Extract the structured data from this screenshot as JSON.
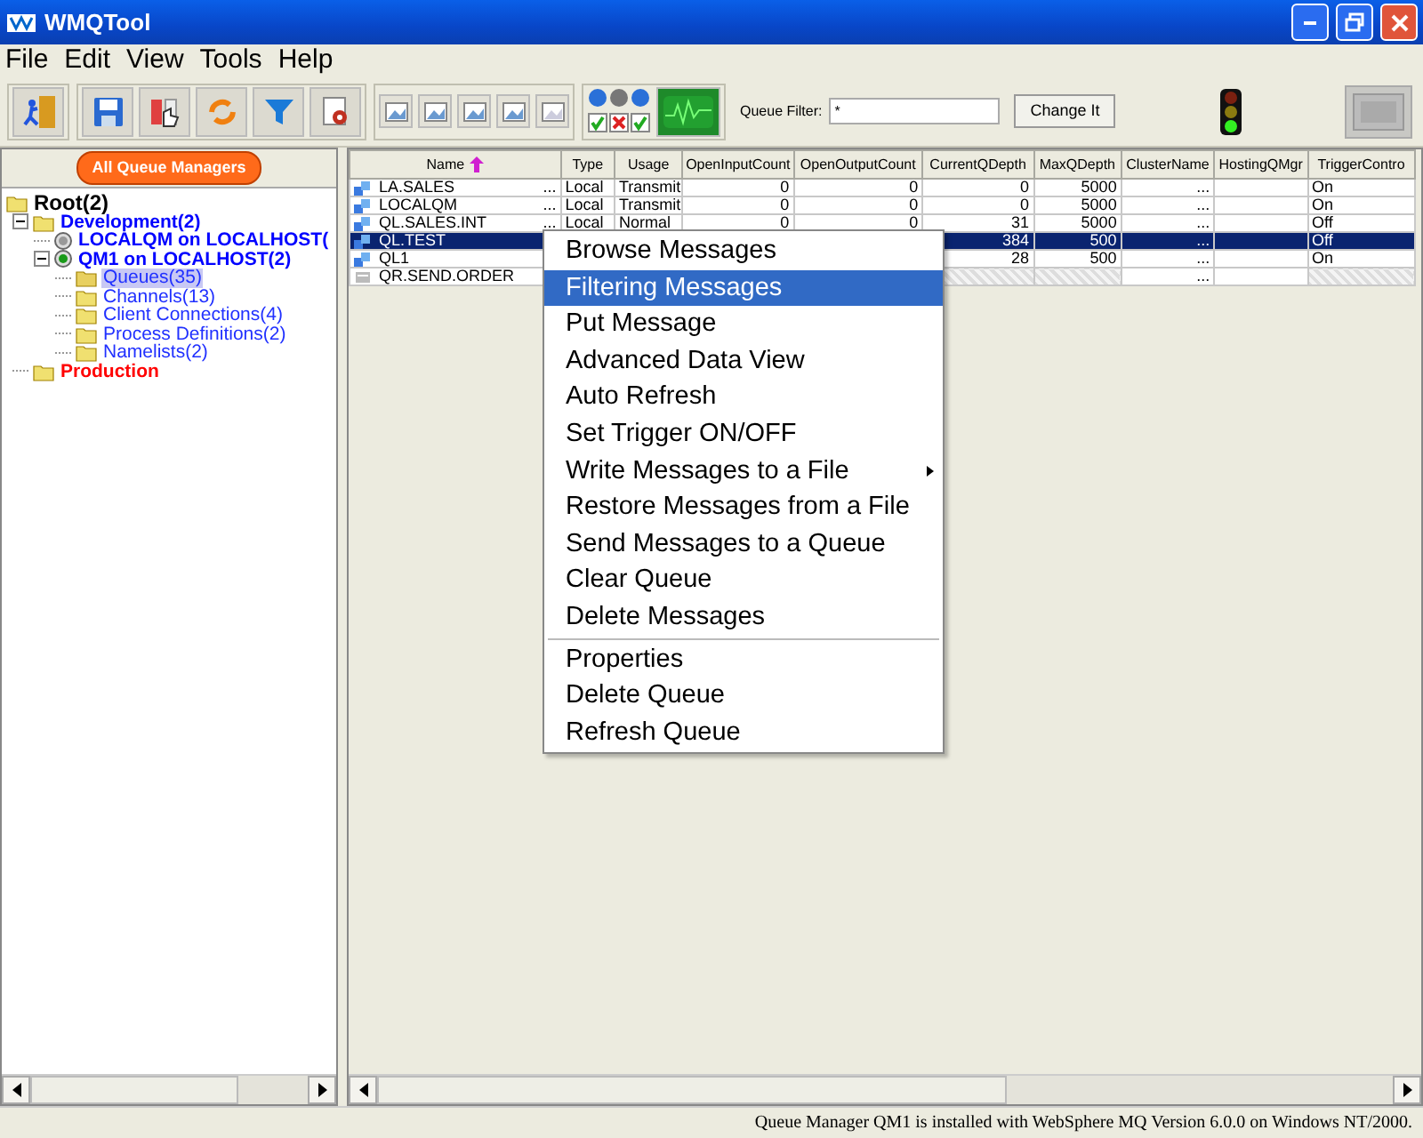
{
  "window": {
    "title": "WMQTool"
  },
  "menu_bar": [
    "File",
    "Edit",
    "View",
    "Tools",
    "Help"
  ],
  "toolbar": {
    "filter_label": "Queue Filter:",
    "filter_value": "*",
    "filter_button": "Change It"
  },
  "tree": {
    "header_button": "All Queue Managers",
    "nodes": [
      {
        "label": "Root(2)",
        "kind": "root",
        "selected": false,
        "children": [
          {
            "label": "Development(2)",
            "kind": "folder",
            "color": "#0000ff",
            "selected": false,
            "children": [
              {
                "label": "LOCALQM on LOCALHOST(",
                "kind": "qmgr",
                "running": false,
                "selected": false
              },
              {
                "label": "QM1 on LOCALHOST(2)",
                "kind": "qmgr",
                "running": true,
                "selected": false,
                "children": [
                  {
                    "label": "Queues(35)",
                    "kind": "object",
                    "selected": true
                  },
                  {
                    "label": "Channels(13)",
                    "kind": "object",
                    "selected": false
                  },
                  {
                    "label": "Client Connections(4)",
                    "kind": "object",
                    "selected": false
                  },
                  {
                    "label": "Process Definitions(2)",
                    "kind": "object",
                    "selected": false
                  },
                  {
                    "label": "Namelists(2)",
                    "kind": "object",
                    "selected": false
                  }
                ]
              }
            ]
          },
          {
            "label": "Production",
            "kind": "folder",
            "color": "#ff0000",
            "selected": false
          }
        ]
      }
    ]
  },
  "table": {
    "columns": [
      {
        "label": "Name",
        "sorted": true
      },
      {
        "label": "Type",
        "sorted": false
      },
      {
        "label": "Usage",
        "sorted": false
      },
      {
        "label": "OpenInputCount",
        "sorted": false
      },
      {
        "label": "OpenOutputCount",
        "sorted": false
      },
      {
        "label": "CurrentQDepth",
        "sorted": false
      },
      {
        "label": "MaxQDepth",
        "sorted": false
      },
      {
        "label": "ClusterName",
        "sorted": false
      },
      {
        "label": "HostingQMgr",
        "sorted": false
      },
      {
        "label": "TriggerContro",
        "sorted": false
      }
    ],
    "rows": [
      {
        "kind": "local",
        "selected": false,
        "name_more": "...",
        "cells": [
          "LA.SALES",
          "Local",
          "Transmit",
          "0",
          "0",
          "0",
          "5000",
          "...",
          null,
          "On"
        ]
      },
      {
        "kind": "local",
        "selected": false,
        "name_more": "...",
        "cells": [
          "LOCALQM",
          "Local",
          "Transmit",
          "0",
          "0",
          "0",
          "5000",
          "...",
          null,
          "On"
        ]
      },
      {
        "kind": "local",
        "selected": false,
        "name_more": "...",
        "cells": [
          "QL.SALES.INT",
          "Local",
          "Normal",
          "0",
          "0",
          "31",
          "5000",
          "...",
          null,
          "Off"
        ]
      },
      {
        "kind": "local",
        "selected": true,
        "cells": [
          "QL.TEST",
          null,
          null,
          null,
          null,
          "384",
          "500",
          "...",
          null,
          "Off"
        ]
      },
      {
        "kind": "local",
        "selected": false,
        "cells": [
          "QL1",
          null,
          null,
          null,
          null,
          "28",
          "500",
          "...",
          null,
          "On"
        ]
      },
      {
        "kind": "remote",
        "selected": false,
        "cells": [
          "QR.SEND.ORDER",
          null,
          null,
          null,
          null,
          null,
          null,
          "...",
          null,
          null
        ]
      }
    ]
  },
  "context_menu": {
    "groups": [
      [
        {
          "label": "Browse Messages",
          "selected": false,
          "submenu": false
        },
        {
          "label": "Filtering Messages",
          "selected": true,
          "submenu": false
        },
        {
          "label": "Put Message",
          "selected": false,
          "submenu": false
        },
        {
          "label": "Advanced Data View",
          "selected": false,
          "submenu": false
        },
        {
          "label": "Auto Refresh",
          "selected": false,
          "submenu": false
        },
        {
          "label": "Set Trigger ON/OFF",
          "selected": false,
          "submenu": false
        },
        {
          "label": "Write Messages to a File",
          "selected": false,
          "submenu": true
        },
        {
          "label": "Restore Messages from a File",
          "selected": false,
          "submenu": false
        },
        {
          "label": "Send Messages to a Queue",
          "selected": false,
          "submenu": false
        },
        {
          "label": "Clear Queue",
          "selected": false,
          "submenu": false
        },
        {
          "label": "Delete Messages",
          "selected": false,
          "submenu": false
        }
      ],
      [
        {
          "label": "Properties",
          "selected": false,
          "submenu": false
        },
        {
          "label": "Delete Queue",
          "selected": false,
          "submenu": false
        },
        {
          "label": "Refresh Queue",
          "selected": false,
          "submenu": false
        }
      ]
    ]
  },
  "status_bar": "Queue Manager QM1 is installed with WebSphere MQ Version 6.0.0 on Windows NT/2000."
}
